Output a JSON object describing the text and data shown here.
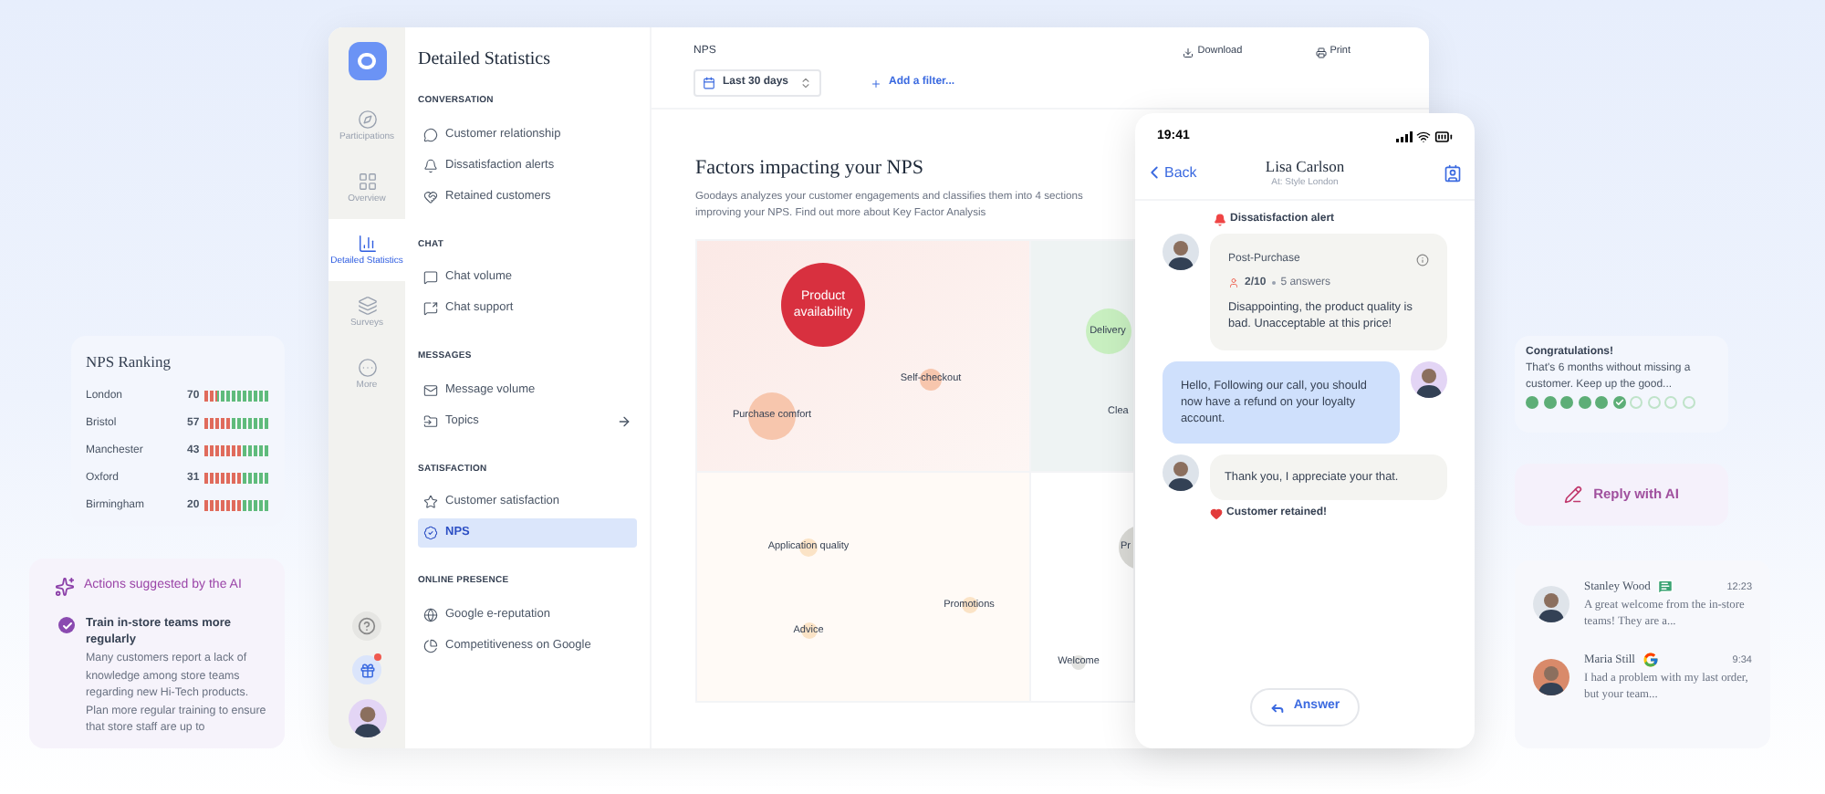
{
  "ranking": {
    "title": "NPS Ranking",
    "rows": [
      {
        "city": "London",
        "score": "70",
        "level": 0.8
      },
      {
        "city": "Bristol",
        "score": "57",
        "level": 0.6
      },
      {
        "city": "Manchester",
        "score": "43",
        "level": 0.45
      },
      {
        "city": "Oxford",
        "score": "31",
        "level": 0.45
      },
      {
        "city": "Birmingham",
        "score": "20",
        "level": 0.45
      }
    ]
  },
  "ai_actions": {
    "title": "Actions suggested by the AI",
    "items": [
      {
        "title": "Train in-store teams more regularly",
        "checked": true,
        "body": "Many customers report a lack of knowledge among store teams regarding new Hi-Tech products. Plan more regular training to ensure that store staff are up to"
      }
    ]
  },
  "rail": {
    "items": [
      {
        "label": "Participations",
        "selected": false
      },
      {
        "label": "Overview",
        "selected": false
      },
      {
        "label": "Detailed Statistics",
        "selected": true
      },
      {
        "label": "Surveys",
        "selected": false
      },
      {
        "label": "More",
        "selected": false
      }
    ],
    "gift_notification": true
  },
  "nav": {
    "title": "Detailed Statistics",
    "sections": [
      {
        "heading": "CONVERSATION",
        "items": [
          {
            "label": "Customer relationship",
            "selected": false
          },
          {
            "label": "Dissatisfaction alerts",
            "selected": false
          },
          {
            "label": "Retained customers",
            "selected": false
          }
        ]
      },
      {
        "heading": "CHAT",
        "items": [
          {
            "label": "Chat volume",
            "selected": false
          },
          {
            "label": "Chat support",
            "selected": false
          }
        ]
      },
      {
        "heading": "MESSAGES",
        "items": [
          {
            "label": "Message volume",
            "selected": false
          },
          {
            "label": "Topics",
            "selected": false,
            "has_arrow": true
          }
        ]
      },
      {
        "heading": "SATISFACTION",
        "items": [
          {
            "label": "Customer satisfaction",
            "selected": false
          },
          {
            "label": "NPS",
            "selected": true
          }
        ]
      },
      {
        "heading": "ONLINE PRESENCE",
        "items": [
          {
            "label": "Google e-reputation",
            "selected": false
          },
          {
            "label": "Competitiveness on Google",
            "selected": false
          }
        ]
      }
    ]
  },
  "header": {
    "title": "NPS",
    "period": "Last 30 days",
    "add_filter": "Add a filter...",
    "actions": [
      "Download",
      "Print"
    ]
  },
  "factors": {
    "title": "Factors impacting your NPS",
    "description_lines": [
      "Goodays analyzes your customer engagements and classifies them into 4 sections",
      "improving your NPS. Find out more about Key Factor Analysis"
    ],
    "bubbles": [
      {
        "label": "Product availability",
        "color": "#d8303f"
      },
      {
        "label": "Self-checkout",
        "color": "#f7c6ad"
      },
      {
        "label": "Purchase comfort",
        "color": "#f7c6ad"
      },
      {
        "label": "Delivery",
        "color": "#c8efc0"
      },
      {
        "label": "Clea"
      },
      {
        "label": "Application quality",
        "color": "#fbe3c6"
      },
      {
        "label": "Promotions",
        "color": "#fbe3c6"
      },
      {
        "label": "Advice",
        "color": "#fbe3c6"
      },
      {
        "label": "Welcome",
        "color": "#e2e2df"
      },
      {
        "label": "Pr",
        "color": "#dadad6"
      }
    ]
  },
  "phone": {
    "time": "19:41",
    "back": "Back",
    "contact": "Lisa Carlson",
    "subtitle": "At: Style London",
    "alert": "Dissatisfaction alert",
    "survey": {
      "name": "Post-Purchase",
      "score": "2/10",
      "answers": "5 answers",
      "text": "Disappointing, the product quality is bad. Unacceptable at this price!"
    },
    "agent_message": "Hello, Following our call, you should now have a refund on your loyalty account.",
    "reply": "Thank you, I appreciate your that.",
    "retained": "Customer retained!",
    "answer_button": "Answer"
  },
  "congrats": {
    "title": "Congratulations!",
    "text": "That's 6 months without missing a customer. Keep up the good...",
    "steps": [
      {
        "done": true
      },
      {
        "done": true
      },
      {
        "done": true
      },
      {
        "done": true
      },
      {
        "done": true
      },
      {
        "done": true
      },
      {
        "done": false
      },
      {
        "done": false
      },
      {
        "done": false
      },
      {
        "done": false
      }
    ]
  },
  "reply_ai": "Reply with AI",
  "messages": [
    {
      "kind": "chat",
      "name": "Stanley Wood",
      "time": "12:23",
      "text": "A great welcome from the in-store teams! They are a..."
    },
    {
      "kind": "google",
      "name": "Maria Still",
      "time": "9:34",
      "text": "I had a problem with my last order, but your team..."
    }
  ]
}
